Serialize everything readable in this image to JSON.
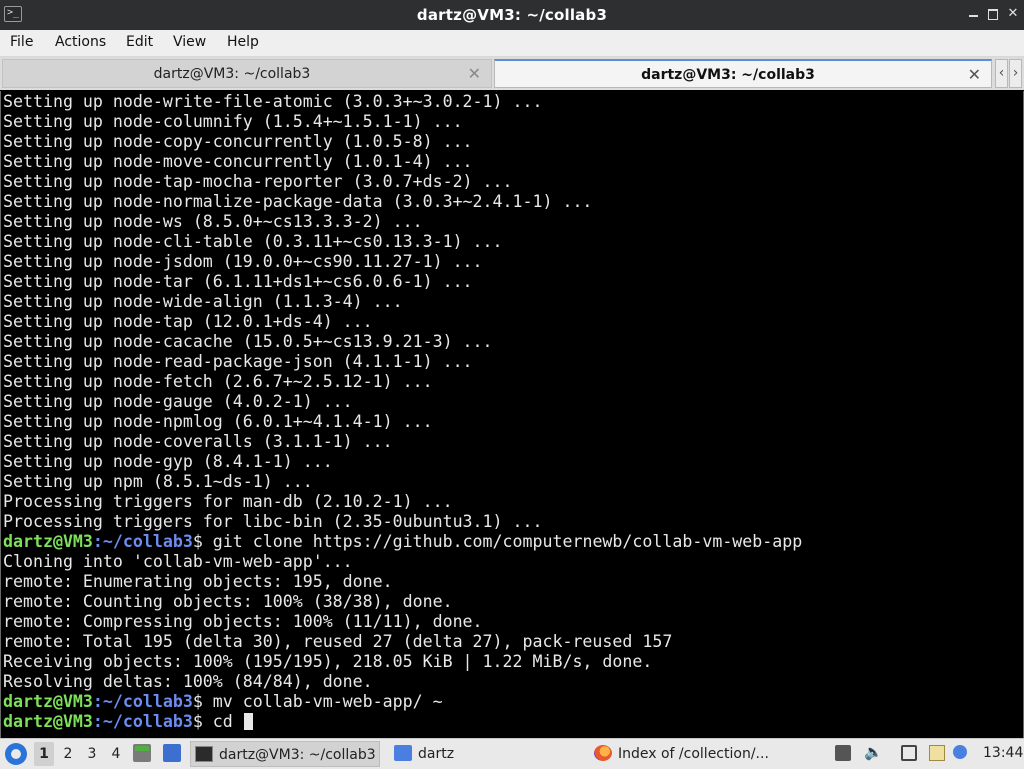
{
  "window": {
    "title": "dartz@VM3: ~/collab3",
    "icon_name": "terminal-icon"
  },
  "menu": {
    "items": [
      "File",
      "Actions",
      "Edit",
      "View",
      "Help"
    ]
  },
  "tabs": [
    {
      "label": "dartz@VM3: ~/collab3",
      "active": false
    },
    {
      "label": "dartz@VM3: ~/collab3",
      "active": true
    }
  ],
  "tab_nav": {
    "prev": "‹",
    "next": "›"
  },
  "terminal": {
    "colors": {
      "background": "#000000",
      "text": "#e8e8e8",
      "prompt_user": "#7ee05a",
      "prompt_path": "#6b8cf0"
    },
    "lines": [
      "Setting up node-write-file-atomic (3.0.3+~3.0.2-1) ...",
      "Setting up node-columnify (1.5.4+~1.5.1-1) ...",
      "Setting up node-copy-concurrently (1.0.5-8) ...",
      "Setting up node-move-concurrently (1.0.1-4) ...",
      "Setting up node-tap-mocha-reporter (3.0.7+ds-2) ...",
      "Setting up node-normalize-package-data (3.0.3+~2.4.1-1) ...",
      "Setting up node-ws (8.5.0+~cs13.3.3-2) ...",
      "Setting up node-cli-table (0.3.11+~cs0.13.3-1) ...",
      "Setting up node-jsdom (19.0.0+~cs90.11.27-1) ...",
      "Setting up node-tar (6.1.11+ds1+~cs6.0.6-1) ...",
      "Setting up node-wide-align (1.1.3-4) ...",
      "Setting up node-tap (12.0.1+ds-4) ...",
      "Setting up node-cacache (15.0.5+~cs13.9.21-3) ...",
      "Setting up node-read-package-json (4.1.1-1) ...",
      "Setting up node-fetch (2.6.7+~2.5.12-1) ...",
      "Setting up node-gauge (4.0.2-1) ...",
      "Setting up node-npmlog (6.0.1+~4.1.4-1) ...",
      "Setting up node-coveralls (3.1.1-1) ...",
      "Setting up node-gyp (8.4.1-1) ...",
      "Setting up npm (8.5.1~ds-1) ...",
      "Processing triggers for man-db (2.10.2-1) ...",
      "Processing triggers for libc-bin (2.35-0ubuntu3.1) ...",
      {
        "user": "dartz@VM3",
        "path": ":~/collab3",
        "cmd": "$ git clone https://github.com/computernewb/collab-vm-web-app"
      },
      "Cloning into 'collab-vm-web-app'...",
      "remote: Enumerating objects: 195, done.",
      "remote: Counting objects: 100% (38/38), done.",
      "remote: Compressing objects: 100% (11/11), done.",
      "remote: Total 195 (delta 30), reused 27 (delta 27), pack-reused 157",
      "Receiving objects: 100% (195/195), 218.05 KiB | 1.22 MiB/s, done.",
      "Resolving deltas: 100% (84/84), done.",
      {
        "user": "dartz@VM3",
        "path": ":~/collab3",
        "cmd": "$ mv collab-vm-web-app/ ~"
      },
      {
        "user": "dartz@VM3",
        "path": ":~/collab3",
        "cmd": "$ cd ",
        "cursor": true
      }
    ]
  },
  "taskbar": {
    "start_icon": "start-menu-icon",
    "workspaces": [
      "1",
      "2",
      "3",
      "4"
    ],
    "active_workspace": "1",
    "quicklaunch": [
      "file-manager-icon",
      "show-desktop-icon"
    ],
    "tasks": [
      {
        "label": "dartz@VM3: ~/collab3",
        "icon": "terminal-icon"
      },
      {
        "label": "dartz",
        "icon": "folder-icon"
      },
      {
        "label": "Index of /collection/...",
        "icon": "firefox-icon"
      }
    ],
    "tray": [
      "app-tray-icon",
      "volume-icon",
      "network-icon",
      "clipboard-icon",
      "update-icon"
    ],
    "clock": "13:44"
  }
}
